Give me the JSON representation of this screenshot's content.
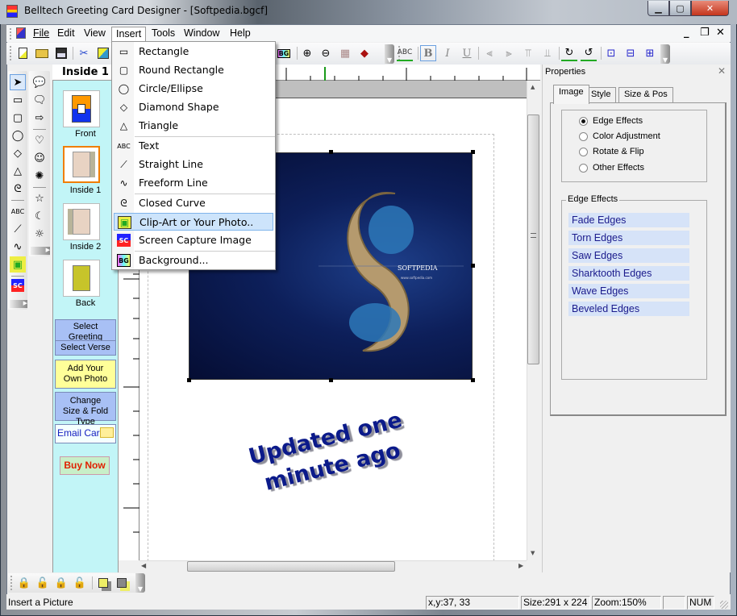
{
  "window": {
    "title": "Belltech Greeting Card Designer  - [Softpedia.bgcf]",
    "controls": {
      "minimize": "▁",
      "maximize": "▢",
      "close": "✕"
    }
  },
  "menubar": {
    "items": [
      "File",
      "Edit",
      "View",
      "Insert",
      "Tools",
      "Window",
      "Help"
    ],
    "open_menu": "Insert",
    "mdi_controls": {
      "minimize": "_",
      "restore": "❐",
      "close": "✕"
    }
  },
  "toolbar": {
    "icons": [
      "new-icon",
      "open-icon",
      "save-icon",
      "cut-icon",
      "paste-icon",
      "background-icon",
      "zoom-in-icon",
      "zoom-out-icon",
      "grid-icon",
      "help-book-icon",
      "spellcheck-icon",
      "bold-icon",
      "italic-icon",
      "underline-icon",
      "align-left-icon",
      "align-right-icon",
      "align-top-icon",
      "align-bottom-icon",
      "rotate-right-icon",
      "rotate-left-icon",
      "center-icon",
      "center-horizontal-icon",
      "center-vertical-icon"
    ],
    "labels": {
      "bg": "BG",
      "spell": "ABC",
      "bold": "B",
      "italic": "I",
      "underline": "U"
    }
  },
  "insert_menu": {
    "items": [
      {
        "label": "Rectangle",
        "icon": "rectangle-icon",
        "glyph": "▭"
      },
      {
        "label": "Round Rectangle",
        "icon": "round-rectangle-icon",
        "glyph": "▢"
      },
      {
        "label": "Circle/Ellipse",
        "icon": "ellipse-icon",
        "glyph": "◯"
      },
      {
        "label": "Diamond Shape",
        "icon": "diamond-icon",
        "glyph": "◇"
      },
      {
        "label": "Triangle",
        "icon": "triangle-icon",
        "glyph": "△"
      },
      {
        "label": "Text",
        "icon": "text-icon",
        "glyph": "ABC"
      },
      {
        "label": "Straight Line",
        "icon": "line-icon",
        "glyph": "⟋"
      },
      {
        "label": "Freeform Line",
        "icon": "freeform-icon",
        "glyph": "∿"
      },
      {
        "label": "Closed Curve",
        "icon": "closed-curve-icon",
        "glyph": "ᘓ"
      },
      {
        "label": "Clip-Art or Your Photo..",
        "icon": "picture-icon",
        "glyph": "▣"
      },
      {
        "label": "Screen Capture Image",
        "icon": "screen-capture-icon",
        "glyph": "SC"
      },
      {
        "label": "Background...",
        "icon": "background-icon",
        "glyph": "BG"
      }
    ],
    "highlighted": "Clip-Art or Your Photo.."
  },
  "tool_palette_1": {
    "tools": [
      {
        "name": "select",
        "glyph": "➤"
      },
      {
        "name": "rectangle",
        "glyph": "▭"
      },
      {
        "name": "round-rectangle",
        "glyph": "▢"
      },
      {
        "name": "ellipse",
        "glyph": "◯"
      },
      {
        "name": "diamond",
        "glyph": "◇"
      },
      {
        "name": "triangle",
        "glyph": "△"
      },
      {
        "name": "closed-curve",
        "glyph": "ᘓ"
      },
      {
        "name": "text",
        "glyph": "ABC"
      },
      {
        "name": "line",
        "glyph": "⟋"
      },
      {
        "name": "freeform",
        "glyph": "∿"
      },
      {
        "name": "picture",
        "glyph": "▣"
      },
      {
        "name": "screen-capture",
        "glyph": "SC"
      }
    ]
  },
  "tool_palette_2": {
    "tools": [
      {
        "name": "speech-bubble",
        "glyph": "💬"
      },
      {
        "name": "thought-bubble",
        "glyph": "🗨"
      },
      {
        "name": "arrow",
        "glyph": "⇨"
      },
      {
        "name": "heart",
        "glyph": "♡"
      },
      {
        "name": "smiley",
        "glyph": "☺"
      },
      {
        "name": "burst",
        "glyph": "✺"
      },
      {
        "name": "star",
        "glyph": "☆"
      },
      {
        "name": "moon",
        "glyph": "☾"
      },
      {
        "name": "sun",
        "glyph": "☼"
      }
    ]
  },
  "pages_panel": {
    "title": "Inside 1",
    "pages": [
      {
        "label": "Front",
        "selected": false
      },
      {
        "label": "Inside 1",
        "selected": true
      },
      {
        "label": "Inside 2",
        "selected": false
      },
      {
        "label": "Back",
        "selected": false
      }
    ],
    "buttons": {
      "select_greeting": "Select Greeting",
      "select_verse": "Select Verse",
      "add_photo": "Add Your Own Photo",
      "change_size": "Change Size & Fold Type",
      "email_card": "Email Card",
      "buy_now": "Buy Now"
    }
  },
  "canvas": {
    "photo_caption": "SOFTPEDIA",
    "photo_url_text": "www.softpedia.com",
    "card_text_line1": "Updated one",
    "card_text_line2": "minute ago",
    "text_color": "#0b1a8a"
  },
  "properties": {
    "title": "Properties",
    "close": "✕",
    "tabs": [
      "Image",
      "Style",
      "Size & Pos"
    ],
    "active_tab": "Image",
    "radio_options": [
      {
        "label": "Edge Effects",
        "checked": true
      },
      {
        "label": "Color Adjustment",
        "checked": false
      },
      {
        "label": "Rotate & Flip",
        "checked": false
      },
      {
        "label": "Other Effects",
        "checked": false
      }
    ],
    "group_title": "Edge Effects",
    "edge_effects": [
      "Fade Edges",
      "Torn Edges",
      "Saw Edges",
      "Sharktooth Edges",
      "Wave Edges",
      "Beveled Edges"
    ]
  },
  "bottom_toolbar": {
    "icons": [
      "lock-icon",
      "unlock-icon",
      "lock-all-icon",
      "unlock-all-icon",
      "bring-front-icon",
      "send-back-icon"
    ]
  },
  "status": {
    "message": "Insert a Picture",
    "coords": "x,y:37, 33",
    "size": "Size:291 x 224",
    "zoom": "Zoom:150%",
    "empty": "",
    "num": "NUM"
  }
}
